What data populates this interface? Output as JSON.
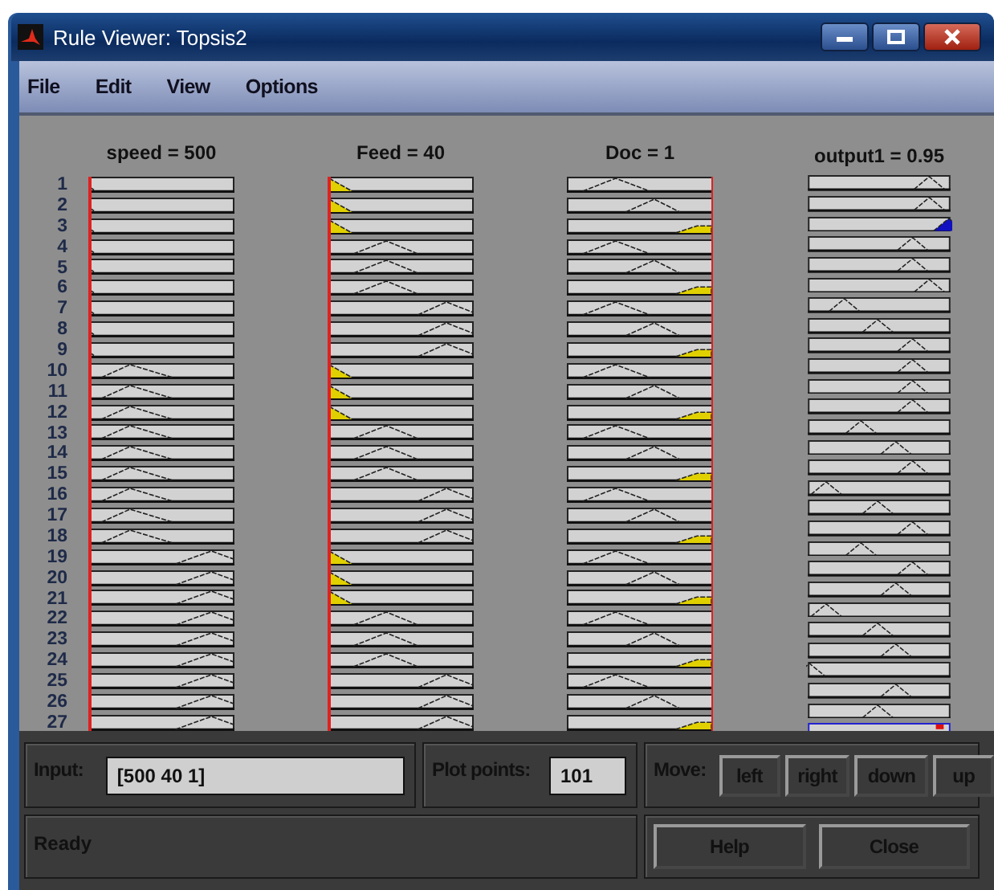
{
  "window": {
    "title": "Rule Viewer: Topsis2"
  },
  "menu": [
    "File",
    "Edit",
    "View",
    "Options"
  ],
  "columns": [
    {
      "title": "speed = 500",
      "kind": "input",
      "marker_at_end": false
    },
    {
      "title": "Feed = 40",
      "kind": "input",
      "marker_at_end": false
    },
    {
      "title": "Doc = 1",
      "kind": "input",
      "marker_at_end": true
    },
    {
      "title": "output1 = 0.95",
      "kind": "output"
    }
  ],
  "rules": [
    {
      "number": "1",
      "cells": [
        {
          "kind": "low",
          "fired": true
        },
        {
          "kind": "low",
          "fired": true
        },
        {
          "kind": "low",
          "fired": false
        },
        {
          "kind": "h",
          "fired": false
        }
      ]
    },
    {
      "number": "2",
      "cells": [
        {
          "kind": "low",
          "fired": true
        },
        {
          "kind": "low",
          "fired": true
        },
        {
          "kind": "mid",
          "fired": false
        },
        {
          "kind": "h",
          "fired": false
        }
      ]
    },
    {
      "number": "3",
      "cells": [
        {
          "kind": "low",
          "fired": true
        },
        {
          "kind": "low",
          "fired": true
        },
        {
          "kind": "high",
          "fired": true
        },
        {
          "kind": "i",
          "fired": true
        }
      ]
    },
    {
      "number": "4",
      "cells": [
        {
          "kind": "low",
          "fired": true
        },
        {
          "kind": "mid",
          "fired": false
        },
        {
          "kind": "low",
          "fired": false
        },
        {
          "kind": "g",
          "fired": false
        }
      ]
    },
    {
      "number": "5",
      "cells": [
        {
          "kind": "low",
          "fired": true
        },
        {
          "kind": "mid",
          "fired": false
        },
        {
          "kind": "mid",
          "fired": false
        },
        {
          "kind": "g",
          "fired": false
        }
      ]
    },
    {
      "number": "6",
      "cells": [
        {
          "kind": "low",
          "fired": true
        },
        {
          "kind": "mid",
          "fired": false
        },
        {
          "kind": "high",
          "fired": true
        },
        {
          "kind": "h",
          "fired": false
        }
      ]
    },
    {
      "number": "7",
      "cells": [
        {
          "kind": "low",
          "fired": true
        },
        {
          "kind": "high",
          "fired": false
        },
        {
          "kind": "low",
          "fired": false
        },
        {
          "kind": "c",
          "fired": false
        }
      ]
    },
    {
      "number": "8",
      "cells": [
        {
          "kind": "low",
          "fired": true
        },
        {
          "kind": "high",
          "fired": false
        },
        {
          "kind": "mid",
          "fired": false
        },
        {
          "kind": "e",
          "fired": false
        }
      ]
    },
    {
      "number": "9",
      "cells": [
        {
          "kind": "low",
          "fired": true
        },
        {
          "kind": "high",
          "fired": false
        },
        {
          "kind": "high",
          "fired": true
        },
        {
          "kind": "g",
          "fired": false
        }
      ]
    },
    {
      "number": "10",
      "cells": [
        {
          "kind": "mid",
          "fired": false
        },
        {
          "kind": "low",
          "fired": true
        },
        {
          "kind": "low",
          "fired": false
        },
        {
          "kind": "g",
          "fired": false
        }
      ]
    },
    {
      "number": "11",
      "cells": [
        {
          "kind": "mid",
          "fired": false
        },
        {
          "kind": "low",
          "fired": true
        },
        {
          "kind": "mid",
          "fired": false
        },
        {
          "kind": "g",
          "fired": false
        }
      ]
    },
    {
      "number": "12",
      "cells": [
        {
          "kind": "mid",
          "fired": false
        },
        {
          "kind": "low",
          "fired": true
        },
        {
          "kind": "high",
          "fired": true
        },
        {
          "kind": "g",
          "fired": false
        }
      ]
    },
    {
      "number": "13",
      "cells": [
        {
          "kind": "mid",
          "fired": false
        },
        {
          "kind": "mid",
          "fired": false
        },
        {
          "kind": "low",
          "fired": false
        },
        {
          "kind": "d",
          "fired": false
        }
      ]
    },
    {
      "number": "14",
      "cells": [
        {
          "kind": "mid",
          "fired": false
        },
        {
          "kind": "mid",
          "fired": false
        },
        {
          "kind": "mid",
          "fired": false
        },
        {
          "kind": "f",
          "fired": false
        }
      ]
    },
    {
      "number": "15",
      "cells": [
        {
          "kind": "mid",
          "fired": false
        },
        {
          "kind": "mid",
          "fired": false
        },
        {
          "kind": "high",
          "fired": true
        },
        {
          "kind": "g",
          "fired": false
        }
      ]
    },
    {
      "number": "16",
      "cells": [
        {
          "kind": "mid",
          "fired": false
        },
        {
          "kind": "high",
          "fired": false
        },
        {
          "kind": "low",
          "fired": false
        },
        {
          "kind": "b",
          "fired": false
        }
      ]
    },
    {
      "number": "17",
      "cells": [
        {
          "kind": "mid",
          "fired": false
        },
        {
          "kind": "high",
          "fired": false
        },
        {
          "kind": "mid",
          "fired": false
        },
        {
          "kind": "e",
          "fired": false
        }
      ]
    },
    {
      "number": "18",
      "cells": [
        {
          "kind": "mid",
          "fired": false
        },
        {
          "kind": "high",
          "fired": false
        },
        {
          "kind": "high",
          "fired": true
        },
        {
          "kind": "g",
          "fired": false
        }
      ]
    },
    {
      "number": "19",
      "cells": [
        {
          "kind": "high",
          "fired": false
        },
        {
          "kind": "low",
          "fired": true
        },
        {
          "kind": "low",
          "fired": false
        },
        {
          "kind": "d",
          "fired": false
        }
      ]
    },
    {
      "number": "20",
      "cells": [
        {
          "kind": "high",
          "fired": false
        },
        {
          "kind": "low",
          "fired": true
        },
        {
          "kind": "mid",
          "fired": false
        },
        {
          "kind": "g",
          "fired": false
        }
      ]
    },
    {
      "number": "21",
      "cells": [
        {
          "kind": "high",
          "fired": false
        },
        {
          "kind": "low",
          "fired": true
        },
        {
          "kind": "high",
          "fired": true
        },
        {
          "kind": "f",
          "fired": false
        }
      ]
    },
    {
      "number": "22",
      "cells": [
        {
          "kind": "high",
          "fired": false
        },
        {
          "kind": "mid",
          "fired": false
        },
        {
          "kind": "low",
          "fired": false
        },
        {
          "kind": "b",
          "fired": false
        }
      ]
    },
    {
      "number": "23",
      "cells": [
        {
          "kind": "high",
          "fired": false
        },
        {
          "kind": "mid",
          "fired": false
        },
        {
          "kind": "mid",
          "fired": false
        },
        {
          "kind": "e",
          "fired": false
        }
      ]
    },
    {
      "number": "24",
      "cells": [
        {
          "kind": "high",
          "fired": false
        },
        {
          "kind": "mid",
          "fired": false
        },
        {
          "kind": "high",
          "fired": true
        },
        {
          "kind": "f",
          "fired": false
        }
      ]
    },
    {
      "number": "25",
      "cells": [
        {
          "kind": "high",
          "fired": false
        },
        {
          "kind": "high",
          "fired": false
        },
        {
          "kind": "low",
          "fired": false
        },
        {
          "kind": "a",
          "fired": false
        }
      ]
    },
    {
      "number": "26",
      "cells": [
        {
          "kind": "high",
          "fired": false
        },
        {
          "kind": "high",
          "fired": false
        },
        {
          "kind": "mid",
          "fired": false
        },
        {
          "kind": "f",
          "fired": false
        }
      ]
    },
    {
      "number": "27",
      "cells": [
        {
          "kind": "high",
          "fired": false
        },
        {
          "kind": "high",
          "fired": false
        },
        {
          "kind": "high",
          "fired": true
        },
        {
          "kind": "e",
          "fired": false
        }
      ]
    }
  ],
  "aggregate": {
    "level": 0.95
  },
  "input": {
    "label": "Input:",
    "value": "[500 40 1]"
  },
  "plot_points": {
    "label": "Plot points:",
    "value": "101"
  },
  "move": {
    "label": "Move:",
    "buttons": [
      "left",
      "right",
      "down",
      "up"
    ]
  },
  "status": "Ready",
  "buttons": [
    "Help",
    "Close"
  ]
}
